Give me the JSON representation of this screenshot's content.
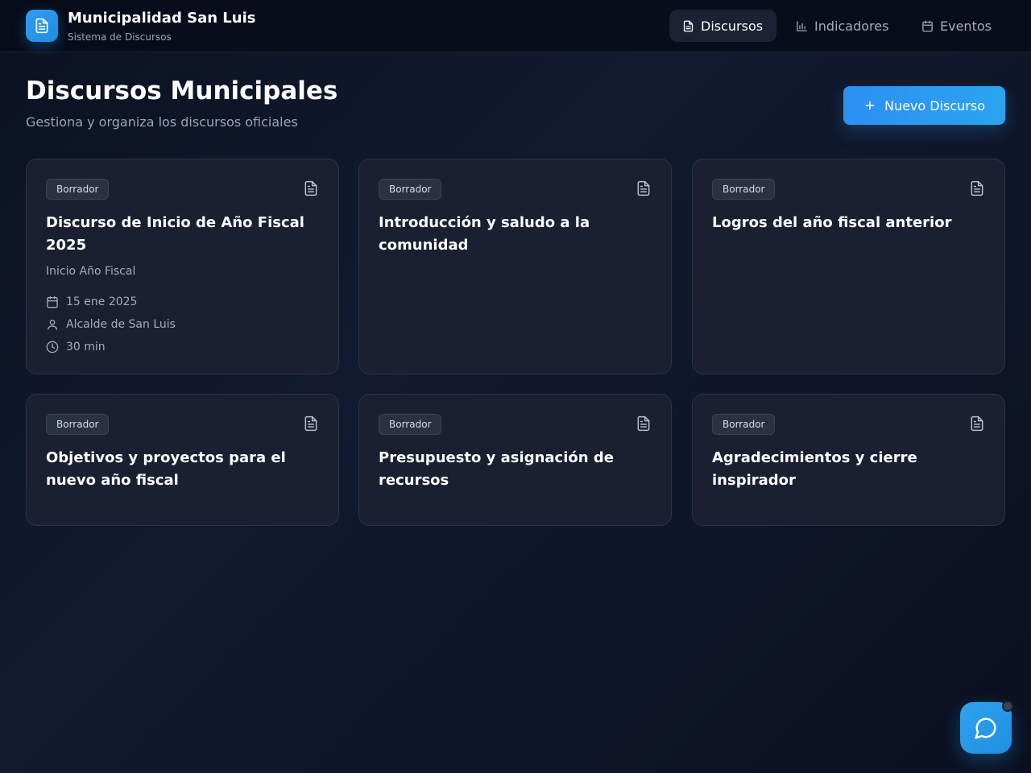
{
  "app": {
    "title": "Municipalidad San Luis",
    "subtitle": "Sistema de Discursos",
    "logo_icon": "document-icon"
  },
  "nav": [
    {
      "label": "Discursos",
      "icon": "document-icon",
      "active": true
    },
    {
      "label": "Indicadores",
      "icon": "bar-chart-icon",
      "active": false
    },
    {
      "label": "Eventos",
      "icon": "calendar-icon",
      "active": false
    }
  ],
  "page": {
    "title": "Discursos Municipales",
    "subtitle": "Gestiona y organiza los discursos oficiales",
    "new_button": "Nuevo Discurso"
  },
  "cards": [
    {
      "status": "Borrador",
      "title": "Discurso de Inicio de Año Fiscal 2025",
      "type": "Inicio Año Fiscal",
      "date": "15 ene 2025",
      "speaker": "Alcalde de San Luis",
      "duration": "30 min"
    },
    {
      "status": "Borrador",
      "title": "Introducción y saludo a la comunidad"
    },
    {
      "status": "Borrador",
      "title": "Logros del año fiscal anterior"
    },
    {
      "status": "Borrador",
      "title": "Objetivos y proyectos para el nuevo año fiscal"
    },
    {
      "status": "Borrador",
      "title": "Presupuesto y asignación de recursos"
    },
    {
      "status": "Borrador",
      "title": "Agradecimientos y cierre inspirador"
    }
  ],
  "colors": {
    "accent": "#2d8ff2",
    "background": "#0e1528",
    "card": "#1b2132",
    "badge": "#2a3142"
  },
  "chat": {
    "icon": "chat-bubble-icon"
  }
}
